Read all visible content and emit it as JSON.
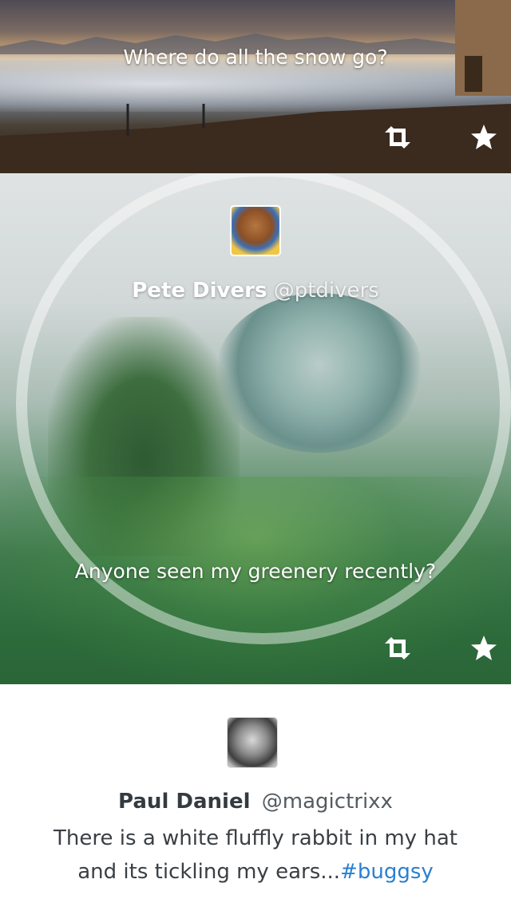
{
  "tweets": [
    {
      "text": "Where do all the snow go?",
      "retweet_icon": "retweet-icon",
      "favorite_icon": "star-icon"
    },
    {
      "author_name": "Pete Divers",
      "author_handle": "@ptdivers",
      "text": "Anyone seen my greenery recently?",
      "avatar": "monkey-avatar",
      "retweet_icon": "retweet-icon",
      "favorite_icon": "star-icon"
    },
    {
      "author_name": "Paul Daniel",
      "author_handle": "@magictrixx",
      "text": "There is a white fluffly rabbit in my hat and its tickling my ears...",
      "hashtag": "#buggsy",
      "avatar": "child-avatar"
    }
  ],
  "colors": {
    "hashtag": "#2a7fcf",
    "text_dark": "#3a3f44",
    "on_photo_text": "#ffffff"
  }
}
